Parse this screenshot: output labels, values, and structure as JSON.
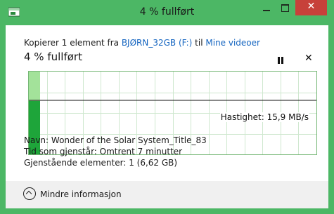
{
  "window": {
    "title": "4 % fullført",
    "close_glyph": "✕"
  },
  "copy": {
    "prefix": "Kopierer 1 element fra ",
    "source": "BJØRN_32GB (F:)",
    "middle": " til ",
    "destination": "Mine videoer"
  },
  "progress": {
    "label": "4 % fullført",
    "percent": 4,
    "speed_label": "Hastighet: 15,9 MB/s",
    "pause_icon": "pause-icon",
    "cancel_glyph": "✕"
  },
  "details": {
    "name_label": "Navn: ",
    "name_value": "Wonder of the Solar System_Title_83",
    "time_label": "Tid som gjenstår: ",
    "time_value": "Omtrent 7 minutter",
    "remaining_label": "Gjenstående elementer: ",
    "remaining_value": "1 (6,62 GB)"
  },
  "footer": {
    "less_info": "Mindre informasjon"
  },
  "colors": {
    "accent": "#4cb765",
    "progress_light": "#a3e29a",
    "progress_dark": "#1ea53a",
    "close": "#c7413a",
    "link": "#1565c0"
  }
}
